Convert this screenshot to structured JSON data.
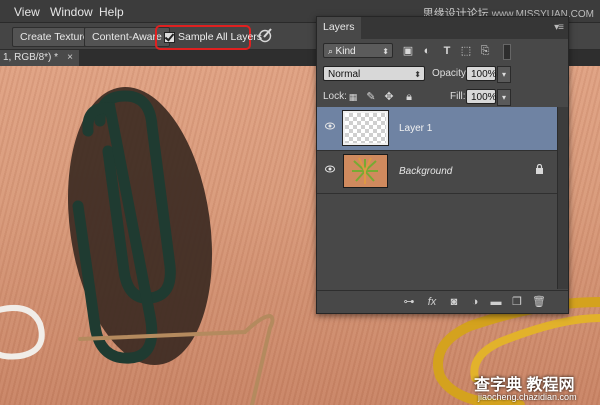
{
  "menu": {
    "items": [
      "View",
      "Window",
      "Help"
    ]
  },
  "watermark": {
    "cn": "思缘设计论坛",
    "url": "www.MISSYUAN.COM"
  },
  "options_bar": {
    "create_texture": "Create Texture",
    "content_aware": "Content-Aware",
    "sample_all_layers": "Sample All Layers",
    "sample_all_layers_checked": true
  },
  "document": {
    "tab_title": "1, RGB/8*) *",
    "close_glyph": "×"
  },
  "layers_panel": {
    "tab_label": "Layers",
    "filter_kind": "Kind",
    "blend_mode": "Normal",
    "opacity_label": "Opacity:",
    "opacity_value": "100%",
    "lock_label": "Lock:",
    "fill_label": "Fill:",
    "fill_value": "100%",
    "layers": [
      {
        "name": "Layer 1",
        "selected": true,
        "visible": true
      },
      {
        "name": "Background",
        "selected": false,
        "visible": true,
        "locked": true
      }
    ],
    "footer_icons": [
      "link-icon",
      "fx-icon",
      "mask-icon",
      "adjustment-icon",
      "group-icon",
      "new-layer-icon",
      "trash-icon"
    ],
    "fx_label": "fx"
  },
  "canvas_watermark": {
    "cn": "查字典 教程网",
    "url": "jiaocheng.chazidian.com"
  },
  "colors": {
    "selection_highlight": "#6f83a3",
    "callout_red": "#e02020",
    "panel_bg": "#484848"
  }
}
